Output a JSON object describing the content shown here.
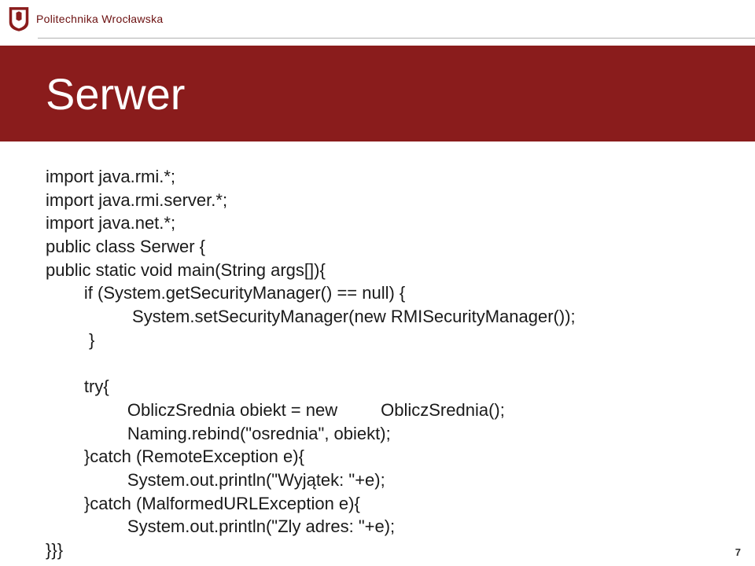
{
  "header": {
    "university": "Politechnika Wrocławska"
  },
  "title": "Serwer",
  "code": {
    "l1": "import java.rmi.*;",
    "l2": "import java.rmi.server.*;",
    "l3": "import java.net.*;",
    "l4": "public class Serwer {",
    "l5": "public static void main(String args[]){",
    "l6": "        if (System.getSecurityManager() == null) {",
    "l7": "                  System.setSecurityManager(new RMISecurityManager());",
    "l8": "         }",
    "l9": "        try{",
    "l10": "                 ObliczSrednia obiekt = new         ObliczSrednia();",
    "l11": "                 Naming.rebind(\"osrednia\", obiekt);",
    "l12": "        }catch (RemoteException e){",
    "l13": "                 System.out.println(\"Wyjątek: \"+e);",
    "l14": "        }catch (MalformedURLException e){",
    "l15": "                 System.out.println(\"Zly adres: \"+e);",
    "l16": "}}}"
  },
  "page": "7"
}
